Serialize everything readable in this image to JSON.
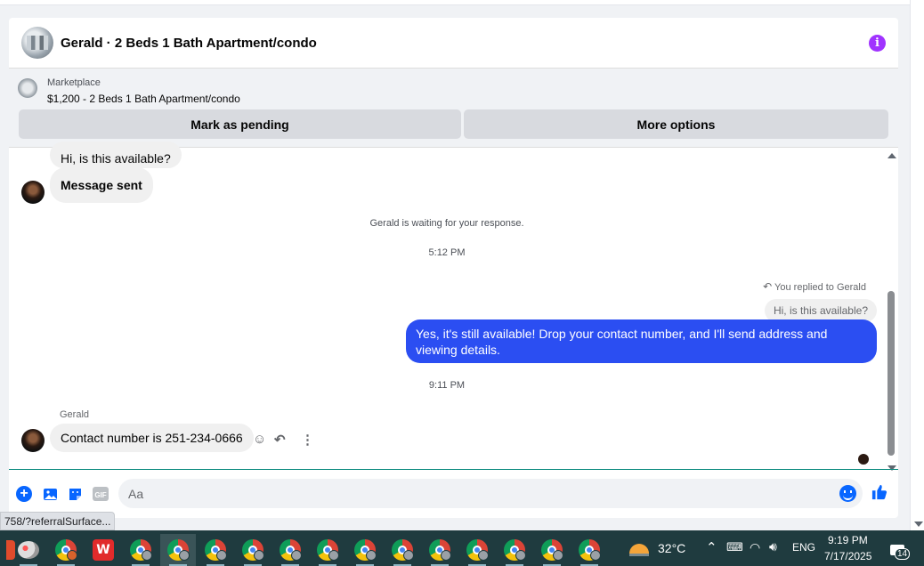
{
  "header": {
    "title": "Gerald · 2 Beds 1 Bath Apartment/condo"
  },
  "marketplace": {
    "label": "Marketplace",
    "listing": "$1,200 - 2 Beds 1 Bath Apartment/condo",
    "mark_pending": "Mark as pending",
    "more_options": "More options"
  },
  "messages": {
    "incoming_1": "Hi, is this available?",
    "incoming_2": "Message sent",
    "waiting_note": "Gerald is waiting for your response.",
    "time_1": "5:12 PM",
    "replied_to": "You replied to Gerald",
    "quoted": "Hi, is this available?",
    "outgoing": "Yes, it's still available! Drop your contact number, and I'll send address and viewing details.",
    "time_2": "9:11 PM",
    "sender_name": "Gerald",
    "incoming_3": "Contact number is 251-234-0666"
  },
  "composer": {
    "placeholder": "Aa"
  },
  "status_tooltip": "758/?referralSurface...",
  "taskbar": {
    "temperature": "32°C",
    "language": "ENG",
    "time": "9:19 PM",
    "date": "7/17/2025",
    "notifications": "14"
  },
  "colors": {
    "accent": "#2b4ef2",
    "info": "#a033ff",
    "taskbar": "#1f3b3f"
  }
}
